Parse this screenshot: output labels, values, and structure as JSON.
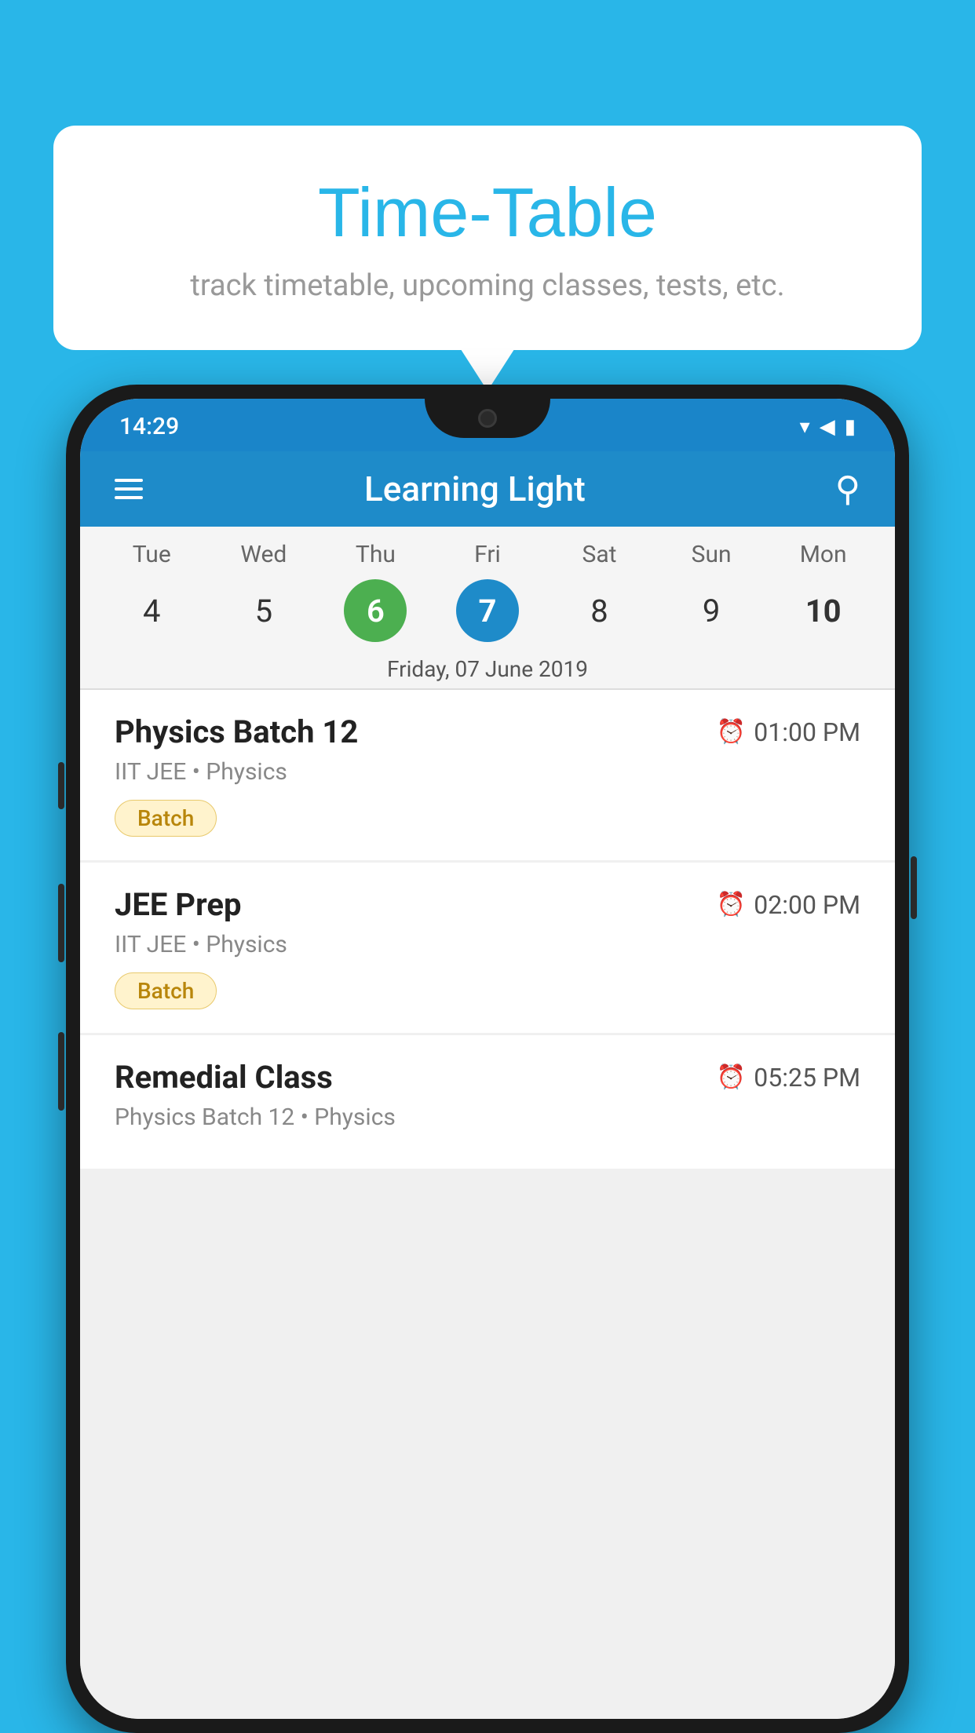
{
  "background_color": "#29B6E8",
  "bubble": {
    "title": "Time-Table",
    "subtitle": "track timetable, upcoming classes, tests, etc."
  },
  "phone": {
    "status_bar": {
      "time": "14:29",
      "icons": [
        "wifi",
        "signal",
        "battery"
      ]
    },
    "app_header": {
      "title": "Learning Light"
    },
    "calendar": {
      "day_labels": [
        "Tue",
        "Wed",
        "Thu",
        "Fri",
        "Sat",
        "Sun",
        "Mon"
      ],
      "dates": [
        "4",
        "5",
        "6",
        "7",
        "8",
        "9",
        "10"
      ],
      "today_index": 2,
      "selected_index": 3,
      "selected_date_label": "Friday, 07 June 2019"
    },
    "schedule_items": [
      {
        "title": "Physics Batch 12",
        "time": "01:00 PM",
        "subtitle": "IIT JEE • Physics",
        "tag": "Batch"
      },
      {
        "title": "JEE Prep",
        "time": "02:00 PM",
        "subtitle": "IIT JEE • Physics",
        "tag": "Batch"
      },
      {
        "title": "Remedial Class",
        "time": "05:25 PM",
        "subtitle": "Physics Batch 12 • Physics",
        "tag": null
      }
    ]
  }
}
